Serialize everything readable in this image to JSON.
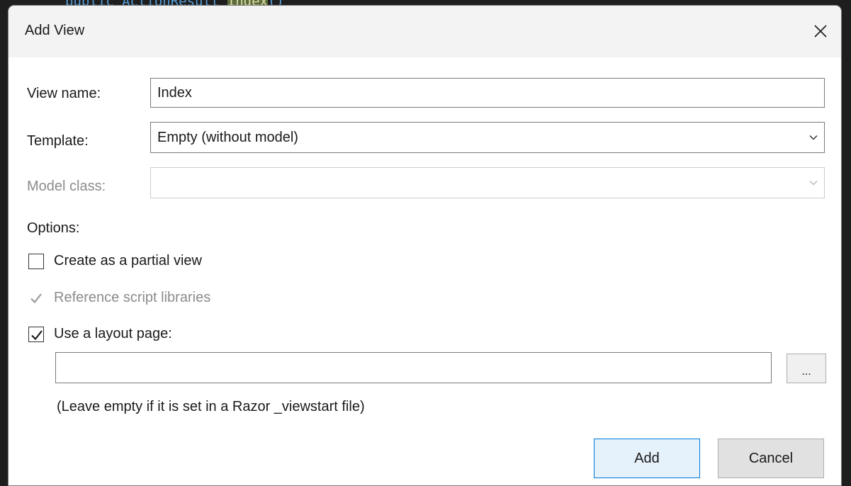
{
  "background": {
    "code_prefix": "public ActionResult ",
    "code_highlight": "Index",
    "code_suffix": "()"
  },
  "dialog": {
    "title": "Add View",
    "close_glyph": "close-icon"
  },
  "form": {
    "view_name_label": "View name:",
    "view_name_value": "Index",
    "template_label": "Template:",
    "template_value": "Empty (without model)",
    "model_class_label": "Model class:",
    "model_class_value": "",
    "options_label": "Options:"
  },
  "options": {
    "partial_view": {
      "label": "Create as a partial view",
      "checked": false,
      "enabled": true
    },
    "script_libraries": {
      "label": "Reference script libraries",
      "checked": true,
      "enabled": false
    },
    "layout_page": {
      "label": "Use a layout page:",
      "checked": true,
      "enabled": true
    }
  },
  "layout": {
    "path_value": "",
    "browse_label": "...",
    "hint": "(Leave empty if it is set in a Razor _viewstart file)"
  },
  "buttons": {
    "add_label": "Add",
    "cancel_label": "Cancel"
  },
  "colors": {
    "accent": "#0078d4",
    "disabled_text": "#8c8c8c"
  }
}
